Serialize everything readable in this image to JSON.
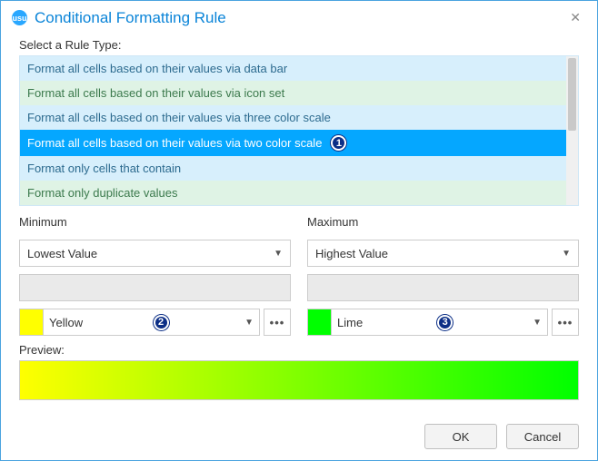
{
  "window": {
    "logo_text": "usu",
    "title": "Conditional Formatting Rule",
    "close_glyph": "✕"
  },
  "labels": {
    "select_rule": "Select a Rule Type:",
    "minimum": "Minimum",
    "maximum": "Maximum",
    "preview": "Preview:"
  },
  "rules": [
    {
      "label": "Format all cells based on their values via data bar",
      "tone": "blue",
      "selected": false
    },
    {
      "label": "Format all cells based on their values via icon set",
      "tone": "green",
      "selected": false
    },
    {
      "label": "Format all cells based on their values via three color scale",
      "tone": "blue",
      "selected": false
    },
    {
      "label": "Format all cells based on their values via two color scale",
      "tone": "selected",
      "selected": true
    },
    {
      "label": "Format only cells that contain",
      "tone": "blue",
      "selected": false
    },
    {
      "label": "Format only duplicate values",
      "tone": "green",
      "selected": false
    }
  ],
  "min": {
    "type": "Lowest Value",
    "color_name": "Yellow",
    "color_hex": "#ffff00"
  },
  "max": {
    "type": "Highest Value",
    "color_name": "Lime",
    "color_hex": "#00ff00"
  },
  "buttons": {
    "ok": "OK",
    "cancel": "Cancel"
  },
  "glyphs": {
    "caret": "▼",
    "more": "•••"
  },
  "markers": {
    "m1": "1",
    "m2": "2",
    "m3": "3"
  }
}
